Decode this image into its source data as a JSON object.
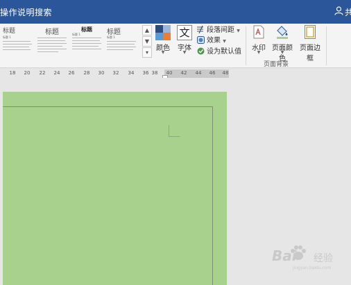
{
  "titlebar": {
    "search_text": "操作说明搜索",
    "user_text": "共"
  },
  "styles_gallery": {
    "items": [
      {
        "title": "标题",
        "heading": "标题 1"
      },
      {
        "title": "标题",
        "heading": ""
      },
      {
        "title": "标题",
        "heading": "标题 1"
      },
      {
        "title": "标题",
        "heading": "标题 1"
      }
    ]
  },
  "ribbon": {
    "colors_label": "颜色",
    "fonts_label": "字体",
    "fonts_glyph": "文",
    "paragraph_spacing": "段落间距",
    "effects": "效果",
    "set_default": "设为默认值",
    "watermark": "水印",
    "page_color": "页面颜色",
    "page_borders": "页面边框",
    "group_page_background": "页面背景"
  },
  "ruler": {
    "ticks": [
      "18",
      "20",
      "22",
      "24",
      "26",
      "28",
      "30",
      "32",
      "34",
      "36",
      "38",
      "40",
      "42",
      "44",
      "46",
      "48"
    ]
  },
  "watermark": {
    "brand": "Bai",
    "jingyan": "经验",
    "url": "jingyan.baidu.com"
  },
  "colors": {
    "title_bar": "#2b579a",
    "page_background": "#a9d18e"
  }
}
